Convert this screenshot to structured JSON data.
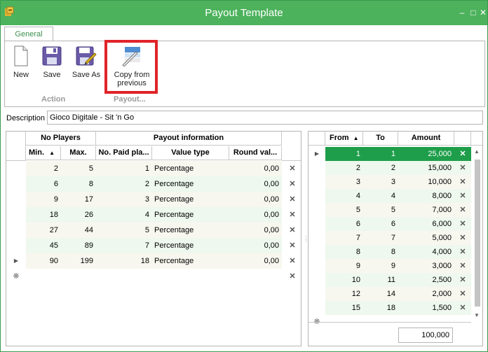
{
  "window": {
    "title": "Payout Template",
    "controls": [
      "minimize-icon",
      "maximize-icon",
      "close-icon"
    ],
    "accent_color": "#4cb25c"
  },
  "tabs": [
    {
      "label": "General",
      "active": true
    }
  ],
  "ribbon": {
    "buttons": [
      {
        "label": "New",
        "icon": "new-document-icon"
      },
      {
        "label": "Save",
        "icon": "save-icon"
      },
      {
        "label": "Save As",
        "icon": "save-as-icon"
      },
      {
        "label_line1": "Copy from",
        "label_line2": "previous",
        "icon": "copy-icon"
      }
    ],
    "groups": [
      {
        "label": "Action"
      },
      {
        "label": "Payout..."
      }
    ]
  },
  "description": {
    "label": "Description",
    "value": "Gioco Digitale - Sit 'n Go"
  },
  "left_grid": {
    "group_headers": [
      "No Players",
      "Payout information"
    ],
    "columns": [
      "Min.",
      "Max.",
      "No. Paid pla...",
      "Value type",
      "Round val..."
    ],
    "rows": [
      {
        "min": "2",
        "max": "5",
        "paid": "1",
        "type": "Percentage",
        "round": "0,00"
      },
      {
        "min": "6",
        "max": "8",
        "paid": "2",
        "type": "Percentage",
        "round": "0,00"
      },
      {
        "min": "9",
        "max": "17",
        "paid": "3",
        "type": "Percentage",
        "round": "0,00"
      },
      {
        "min": "18",
        "max": "26",
        "paid": "4",
        "type": "Percentage",
        "round": "0,00"
      },
      {
        "min": "27",
        "max": "44",
        "paid": "5",
        "type": "Percentage",
        "round": "0,00"
      },
      {
        "min": "45",
        "max": "89",
        "paid": "7",
        "type": "Percentage",
        "round": "0,00"
      },
      {
        "min": "90",
        "max": "199",
        "paid": "18",
        "type": "Percentage",
        "round": "0,00"
      }
    ],
    "current_row_index": 6
  },
  "right_grid": {
    "columns": [
      "From",
      "To",
      "Amount"
    ],
    "rows": [
      {
        "from": "1",
        "to": "1",
        "amount": "25,000"
      },
      {
        "from": "2",
        "to": "2",
        "amount": "15,000"
      },
      {
        "from": "3",
        "to": "3",
        "amount": "10,000"
      },
      {
        "from": "4",
        "to": "4",
        "amount": "8,000"
      },
      {
        "from": "5",
        "to": "5",
        "amount": "7,000"
      },
      {
        "from": "6",
        "to": "6",
        "amount": "6,000"
      },
      {
        "from": "7",
        "to": "7",
        "amount": "5,000"
      },
      {
        "from": "8",
        "to": "8",
        "amount": "4,000"
      },
      {
        "from": "9",
        "to": "9",
        "amount": "3,000"
      },
      {
        "from": "10",
        "to": "11",
        "amount": "2,500"
      },
      {
        "from": "12",
        "to": "14",
        "amount": "2,000"
      },
      {
        "from": "15",
        "to": "18",
        "amount": "1,500"
      }
    ],
    "selected_row_index": 0,
    "selected_color": "#1e9e4a",
    "total": "100,000"
  }
}
